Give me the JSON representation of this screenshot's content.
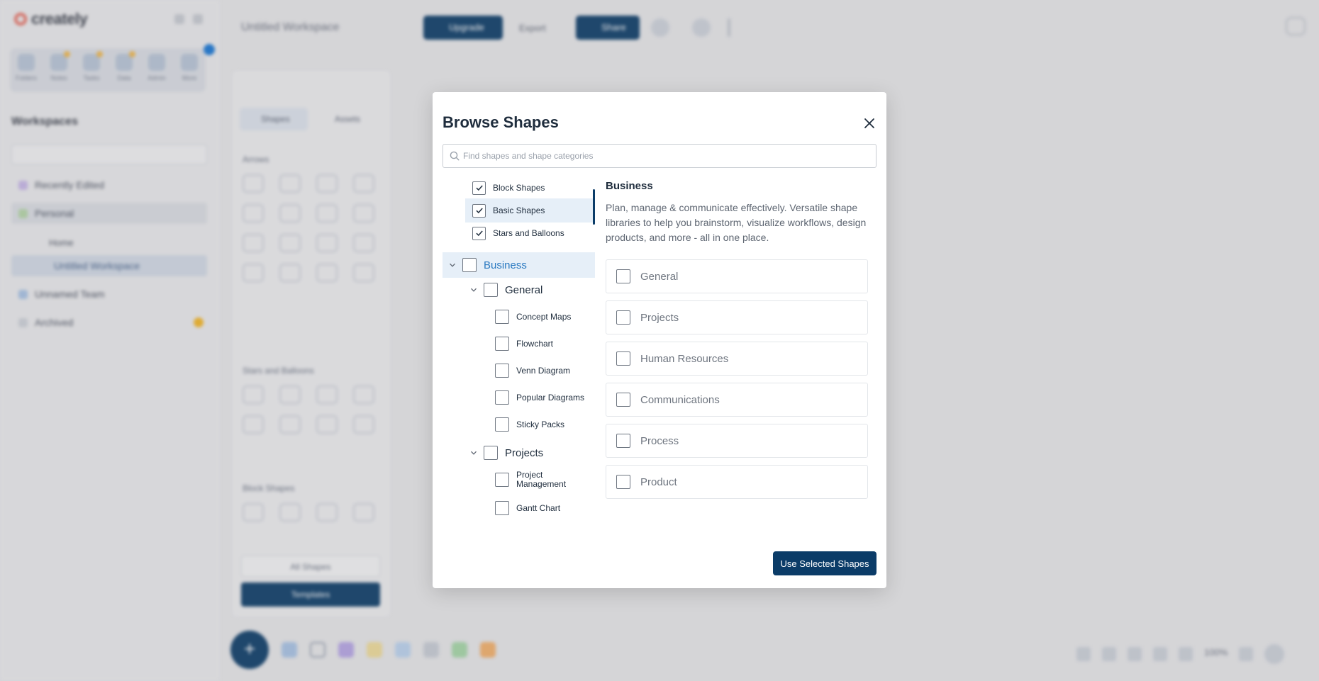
{
  "colors": {
    "primary": "#0b3c68",
    "highlight": "#e6eff8",
    "highlight_text": "#2b7ac1",
    "notification": "#1877d6",
    "star": "#f5b624",
    "brand": "#e8695b"
  },
  "background": {
    "brand_name": "creately",
    "workspaces_heading": "Workspaces",
    "workspace_title": "Untitled Workspace",
    "upgrade_label": "Upgrade",
    "export_label": "Export",
    "share_label": "Share",
    "zoom_level": "100%",
    "tools": [
      "Folders",
      "Notes",
      "Tasks",
      "Data",
      "Admin",
      "More"
    ],
    "nav": [
      "Recently Edited",
      "Personal",
      "Home",
      "Untitled Workspace",
      "Unnamed Team",
      "Archived"
    ],
    "shape_tabs": [
      "Shapes",
      "Assets"
    ],
    "shape_sections": [
      "Arrows",
      "Stars and Balloons",
      "Block Shapes"
    ],
    "all_shapes_label": "All Shapes",
    "templates_label": "Templates"
  },
  "modal": {
    "title": "Browse Shapes",
    "search_placeholder": "Find shapes and shape categories",
    "selected_libraries": [
      {
        "label": "Block Shapes",
        "checked": true
      },
      {
        "label": "Basic Shapes",
        "checked": true
      },
      {
        "label": "Stars and Balloons",
        "checked": true
      }
    ],
    "category": {
      "label": "Business",
      "checked": false
    },
    "groups": [
      {
        "label": "General",
        "items": [
          "Concept Maps",
          "Flowchart",
          "Venn Diagram",
          "Popular Diagrams",
          "Sticky Packs"
        ]
      },
      {
        "label": "Projects",
        "items": [
          "Project Management",
          "Gantt Chart"
        ]
      }
    ],
    "detail": {
      "title": "Business",
      "description": "Plan, manage & communicate effectively. Versatile shape libraries to help you brainstorm, visualize workflows, design products, and more - all in one place.",
      "tiles": [
        "General",
        "Projects",
        "Human Resources",
        "Communications",
        "Process",
        "Product"
      ]
    },
    "use_button_label": "Use Selected Shapes"
  }
}
